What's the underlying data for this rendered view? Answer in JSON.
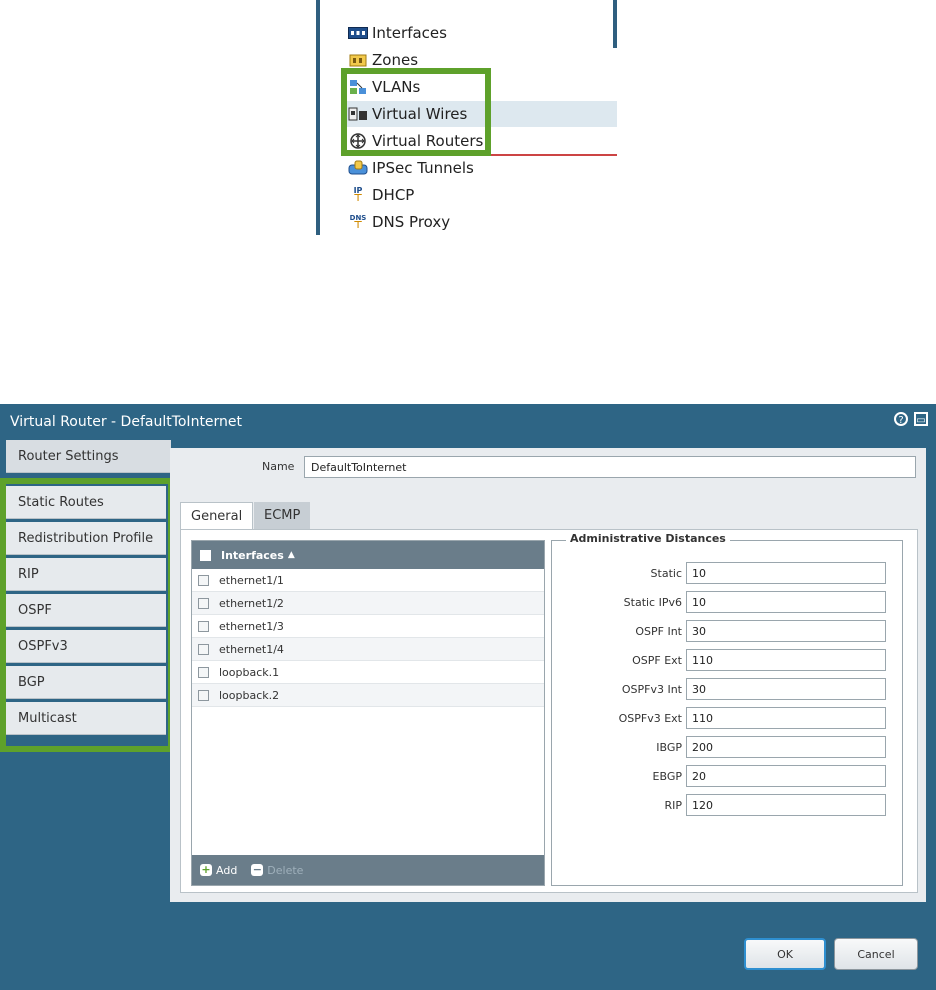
{
  "menu": {
    "items": [
      {
        "label": "Interfaces",
        "icon": "interfaces-icon"
      },
      {
        "label": "Zones",
        "icon": "zones-icon"
      },
      {
        "label": "VLANs",
        "icon": "vlans-icon"
      },
      {
        "label": "Virtual Wires",
        "icon": "virtual-wires-icon"
      },
      {
        "label": "Virtual Routers",
        "icon": "virtual-routers-icon"
      },
      {
        "label": "IPSec Tunnels",
        "icon": "ipsec-tunnels-icon"
      },
      {
        "label": "DHCP",
        "icon": "dhcp-icon",
        "icon_text": "IP"
      },
      {
        "label": "DNS Proxy",
        "icon": "dns-proxy-icon",
        "icon_text": "DNS"
      }
    ],
    "highlighted": "Virtual Wires"
  },
  "dialog": {
    "title": "Virtual Router - DefaultToInternet",
    "help_icon": "help-icon",
    "maximize_icon": "maximize-icon",
    "left_tabs": [
      "Router Settings",
      "Static Routes",
      "Redistribution Profile",
      "RIP",
      "OSPF",
      "OSPFv3",
      "BGP",
      "Multicast"
    ],
    "active_left_tab": "Router Settings",
    "name_label": "Name",
    "name_value": "DefaultToInternet",
    "tabs": [
      "General",
      "ECMP"
    ],
    "active_tab": "General",
    "interfaces_header": "Interfaces",
    "interfaces_sort": "▲",
    "interfaces": [
      "ethernet1/1",
      "ethernet1/2",
      "ethernet1/3",
      "ethernet1/4",
      "loopback.1",
      "loopback.2"
    ],
    "add_label": "Add",
    "delete_label": "Delete",
    "admin_distances_title": "Administrative Distances",
    "admin_distances": [
      {
        "label": "Static",
        "value": "10"
      },
      {
        "label": "Static IPv6",
        "value": "10"
      },
      {
        "label": "OSPF Int",
        "value": "30"
      },
      {
        "label": "OSPF Ext",
        "value": "110"
      },
      {
        "label": "OSPFv3 Int",
        "value": "30"
      },
      {
        "label": "OSPFv3 Ext",
        "value": "110"
      },
      {
        "label": "IBGP",
        "value": "200"
      },
      {
        "label": "EBGP",
        "value": "20"
      },
      {
        "label": "RIP",
        "value": "120"
      }
    ],
    "ok_label": "OK",
    "cancel_label": "Cancel"
  },
  "colors": {
    "dialog_bg": "#2e6585",
    "highlight_green": "#5ea12b",
    "grid_header": "#6a7d8a"
  }
}
